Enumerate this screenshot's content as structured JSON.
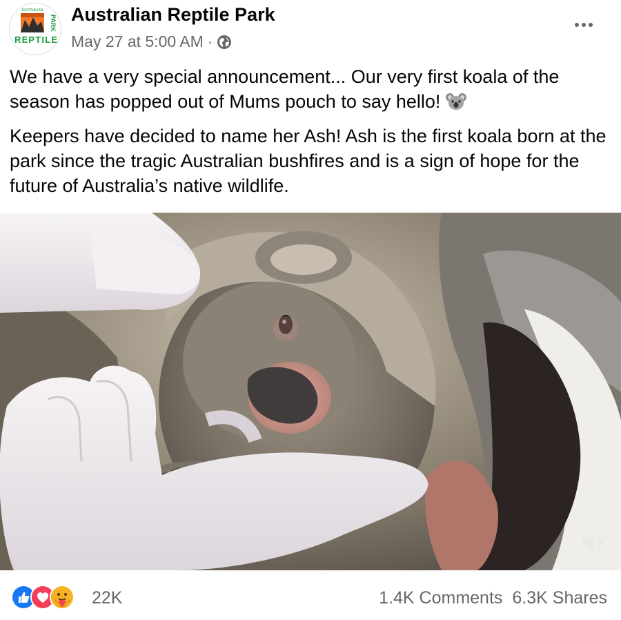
{
  "post": {
    "page_name": "Australian Reptile Park",
    "timestamp": "May 27 at 5:00 AM",
    "separator": "·",
    "privacy_icon": "globe-icon",
    "more_icon": "ellipsis-icon",
    "logo": {
      "top_text": "AUSTRALIAN",
      "side_text": "PARK",
      "bottom_text": "REPTILE",
      "colors": {
        "green": "#1a9a3c",
        "orange": "#f2792a",
        "dark": "#333333"
      }
    },
    "text_paragraph_1": "We have a very special announcement... Our very first koala of the season has popped out of Mums pouch to say hello!",
    "emoji": "koala-emoji",
    "text_paragraph_2": "Keepers have decided to name her Ash! Ash is the first koala born at the park since the tragic Australian bushfires and is a sign of hope for the future of Australia’s native wildlife."
  },
  "media": {
    "type": "video",
    "mute_icon": "speaker-muted-icon"
  },
  "footer": {
    "reactions": [
      "like-reaction",
      "love-reaction",
      "care-reaction"
    ],
    "reaction_count": "22K",
    "comments": "1.4K Comments",
    "shares": "6.3K Shares"
  },
  "colors": {
    "text": "#050505",
    "secondary_text": "#65676b",
    "like_blue": "#1877f2",
    "love_red": "#f33e58",
    "care_yellow": "#f7b125"
  }
}
